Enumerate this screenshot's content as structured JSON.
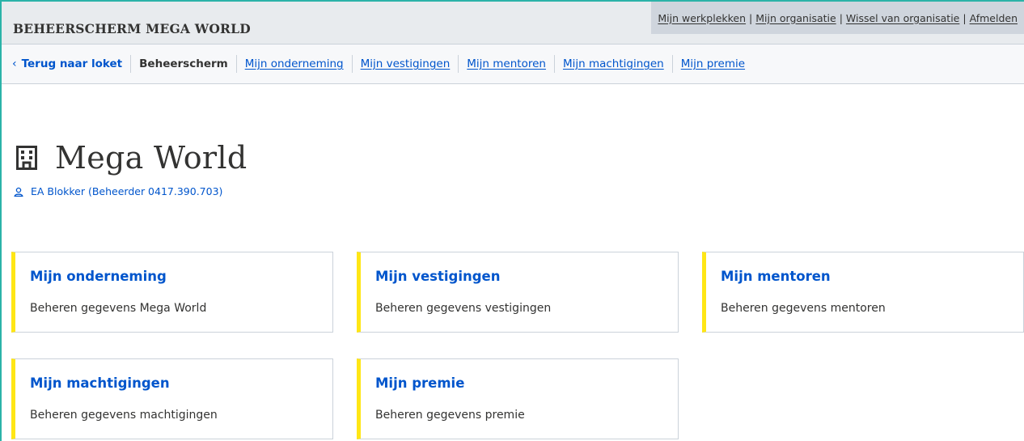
{
  "header": {
    "site_title": "BEHEERSCHERM MEGA WORLD",
    "profile_links": [
      "Mijn werkplekken",
      "Mijn organisatie",
      "Wissel van organisatie",
      "Afmelden"
    ],
    "separator": "|"
  },
  "nav": {
    "back_icon": "chevron-left-icon",
    "back_label": "Terug naar loket",
    "current": "Beheerscherm",
    "links": [
      "Mijn onderneming",
      "Mijn vestigingen",
      "Mijn mentoren",
      "Mijn machtigingen",
      "Mijn premie"
    ]
  },
  "org": {
    "icon": "building-icon",
    "name": "Mega World",
    "user_icon": "user-icon",
    "user": "EA Blokker (Beheerder 0417.390.703)"
  },
  "cards": [
    {
      "title": "Mijn onderneming",
      "text": "Beheren gegevens Mega World"
    },
    {
      "title": "Mijn vestigingen",
      "text": "Beheren gegevens vestigingen"
    },
    {
      "title": "Mijn mentoren",
      "text": "Beheren gegevens mentoren"
    },
    {
      "title": "Mijn machtigingen",
      "text": "Beheren gegevens machtigingen"
    },
    {
      "title": "Mijn premie",
      "text": "Beheren gegevens premie"
    }
  ],
  "colors": {
    "link": "#0055cc",
    "card_accent": "#ffe615",
    "frame": "#2bb3a8"
  }
}
